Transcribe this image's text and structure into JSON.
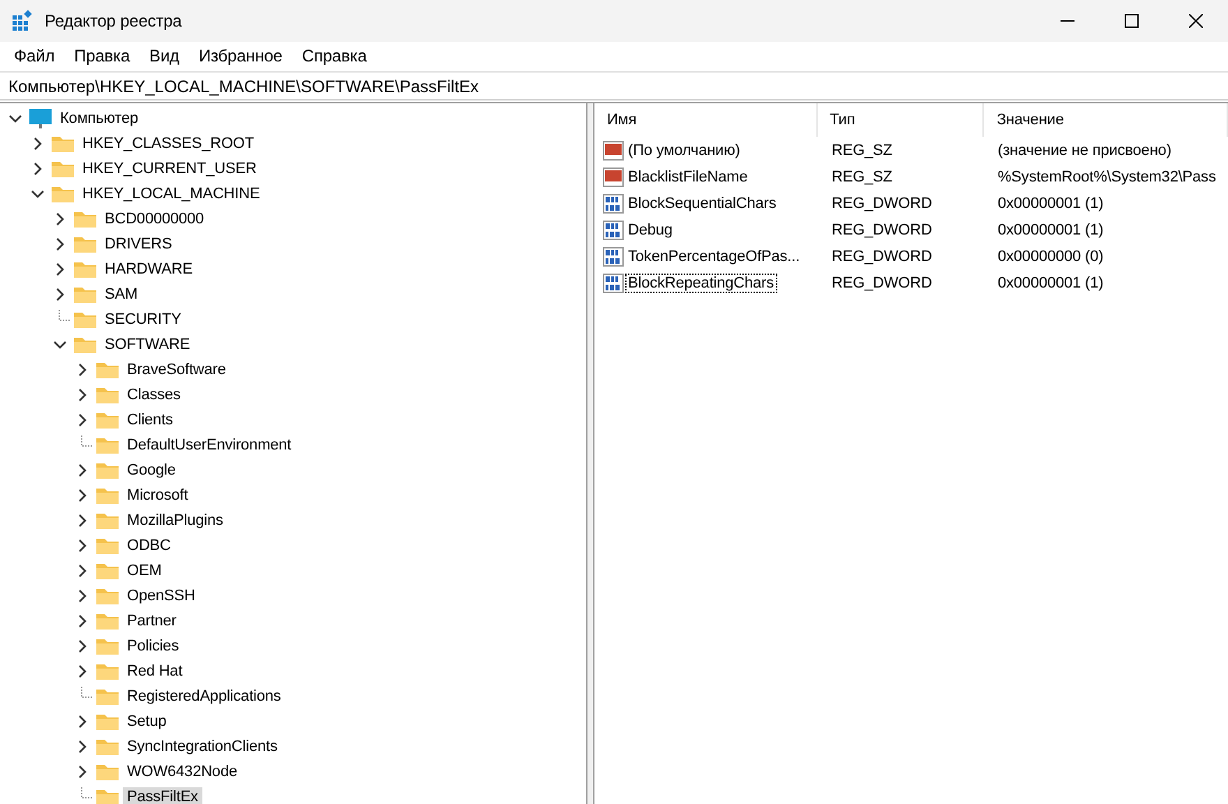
{
  "window": {
    "title": "Редактор реестра"
  },
  "menu": [
    "Файл",
    "Правка",
    "Вид",
    "Избранное",
    "Справка"
  ],
  "address": {
    "value": "Компьютер\\HKEY_LOCAL_MACHINE\\SOFTWARE\\PassFiltEx"
  },
  "tree": [
    {
      "label": "Компьютер",
      "kind": "computer",
      "expandable": true,
      "expanded": true,
      "selected": false,
      "children": [
        {
          "label": "HKEY_CLASSES_ROOT",
          "kind": "folder",
          "expandable": true,
          "expanded": false,
          "selected": false
        },
        {
          "label": "HKEY_CURRENT_USER",
          "kind": "folder",
          "expandable": true,
          "expanded": false,
          "selected": false
        },
        {
          "label": "HKEY_LOCAL_MACHINE",
          "kind": "folder",
          "expandable": true,
          "expanded": true,
          "selected": false,
          "children": [
            {
              "label": "BCD00000000",
              "kind": "folder",
              "expandable": true,
              "expanded": false,
              "selected": false
            },
            {
              "label": "DRIVERS",
              "kind": "folder",
              "expandable": true,
              "expanded": false,
              "selected": false
            },
            {
              "label": "HARDWARE",
              "kind": "folder",
              "expandable": true,
              "expanded": false,
              "selected": false
            },
            {
              "label": "SAM",
              "kind": "folder",
              "expandable": true,
              "expanded": false,
              "selected": false
            },
            {
              "label": "SECURITY",
              "kind": "folder",
              "expandable": false,
              "selected": false
            },
            {
              "label": "SOFTWARE",
              "kind": "folder",
              "expandable": true,
              "expanded": true,
              "selected": false,
              "children": [
                {
                  "label": "BraveSoftware",
                  "kind": "folder",
                  "expandable": true,
                  "expanded": false,
                  "selected": false
                },
                {
                  "label": "Classes",
                  "kind": "folder",
                  "expandable": true,
                  "expanded": false,
                  "selected": false
                },
                {
                  "label": "Clients",
                  "kind": "folder",
                  "expandable": true,
                  "expanded": false,
                  "selected": false
                },
                {
                  "label": "DefaultUserEnvironment",
                  "kind": "folder",
                  "expandable": false,
                  "selected": false
                },
                {
                  "label": "Google",
                  "kind": "folder",
                  "expandable": true,
                  "expanded": false,
                  "selected": false
                },
                {
                  "label": "Microsoft",
                  "kind": "folder",
                  "expandable": true,
                  "expanded": false,
                  "selected": false
                },
                {
                  "label": "MozillaPlugins",
                  "kind": "folder",
                  "expandable": true,
                  "expanded": false,
                  "selected": false
                },
                {
                  "label": "ODBC",
                  "kind": "folder",
                  "expandable": true,
                  "expanded": false,
                  "selected": false
                },
                {
                  "label": "OEM",
                  "kind": "folder",
                  "expandable": true,
                  "expanded": false,
                  "selected": false
                },
                {
                  "label": "OpenSSH",
                  "kind": "folder",
                  "expandable": true,
                  "expanded": false,
                  "selected": false
                },
                {
                  "label": "Partner",
                  "kind": "folder",
                  "expandable": true,
                  "expanded": false,
                  "selected": false
                },
                {
                  "label": "Policies",
                  "kind": "folder",
                  "expandable": true,
                  "expanded": false,
                  "selected": false
                },
                {
                  "label": "Red Hat",
                  "kind": "folder",
                  "expandable": true,
                  "expanded": false,
                  "selected": false
                },
                {
                  "label": "RegisteredApplications",
                  "kind": "folder",
                  "expandable": false,
                  "selected": false
                },
                {
                  "label": "Setup",
                  "kind": "folder",
                  "expandable": true,
                  "expanded": false,
                  "selected": false
                },
                {
                  "label": "SyncIntegrationClients",
                  "kind": "folder",
                  "expandable": true,
                  "expanded": false,
                  "selected": false
                },
                {
                  "label": "WOW6432Node",
                  "kind": "folder",
                  "expandable": true,
                  "expanded": false,
                  "selected": false
                },
                {
                  "label": "PassFiltEx",
                  "kind": "folder",
                  "expandable": false,
                  "selected": true
                }
              ]
            }
          ]
        }
      ]
    }
  ],
  "table": {
    "columns": [
      "Имя",
      "Тип",
      "Значение"
    ],
    "rows": [
      {
        "kind": "string",
        "name": "(По умолчанию)",
        "type": "REG_SZ",
        "value": "(значение не присвоено)",
        "focused": false
      },
      {
        "kind": "string",
        "name": "BlacklistFileName",
        "type": "REG_SZ",
        "value": "%SystemRoot%\\System32\\Pass",
        "focused": false
      },
      {
        "kind": "dword",
        "name": "BlockSequentialChars",
        "type": "REG_DWORD",
        "value": "0x00000001 (1)",
        "focused": false
      },
      {
        "kind": "dword",
        "name": "Debug",
        "type": "REG_DWORD",
        "value": "0x00000001 (1)",
        "focused": false
      },
      {
        "kind": "dword",
        "name": "TokenPercentageOfPas...",
        "type": "REG_DWORD",
        "value": "0x00000000 (0)",
        "focused": false
      },
      {
        "kind": "dword",
        "name": "BlockRepeatingChars",
        "type": "REG_DWORD",
        "value": "0x00000001 (1)",
        "focused": true
      }
    ]
  }
}
